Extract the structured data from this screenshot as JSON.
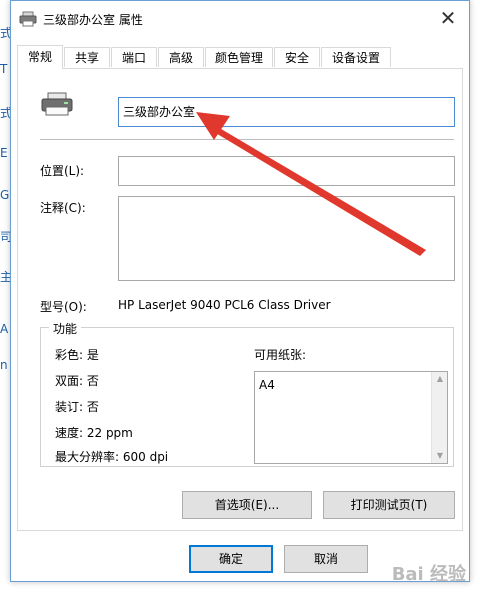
{
  "background": {
    "chars": [
      "式",
      "T",
      "式",
      "E",
      "G",
      "司",
      "主",
      "A",
      "n"
    ]
  },
  "dialog": {
    "title": "三级部办公室 属性",
    "close_icon": "close-icon"
  },
  "tabs": [
    "常规",
    "共享",
    "端口",
    "高级",
    "颜色管理",
    "安全",
    "设备设置"
  ],
  "general": {
    "printer_name": "三级部办公室",
    "location_label": "位置(L):",
    "location_value": "",
    "comment_label": "注释(C):",
    "comment_value": "",
    "model_label": "型号(O):",
    "model_value": "HP LaserJet 9040 PCL6 Class Driver"
  },
  "features": {
    "title": "功能",
    "color": "彩色: 是",
    "duplex": "双面: 否",
    "staple": "装订: 否",
    "speed": "速度: 22 ppm",
    "max_resolution": "最大分辨率: 600 dpi",
    "paper_label": "可用纸张:",
    "paper_items": [
      "A4"
    ]
  },
  "buttons": {
    "preferences": "首选项(E)...",
    "print_test_page": "打印测试页(T)",
    "ok": "确定",
    "cancel": "取消"
  },
  "watermark": "Bai 经验",
  "colors": {
    "accent": "#0078d7",
    "arrow": "#e0382c"
  }
}
